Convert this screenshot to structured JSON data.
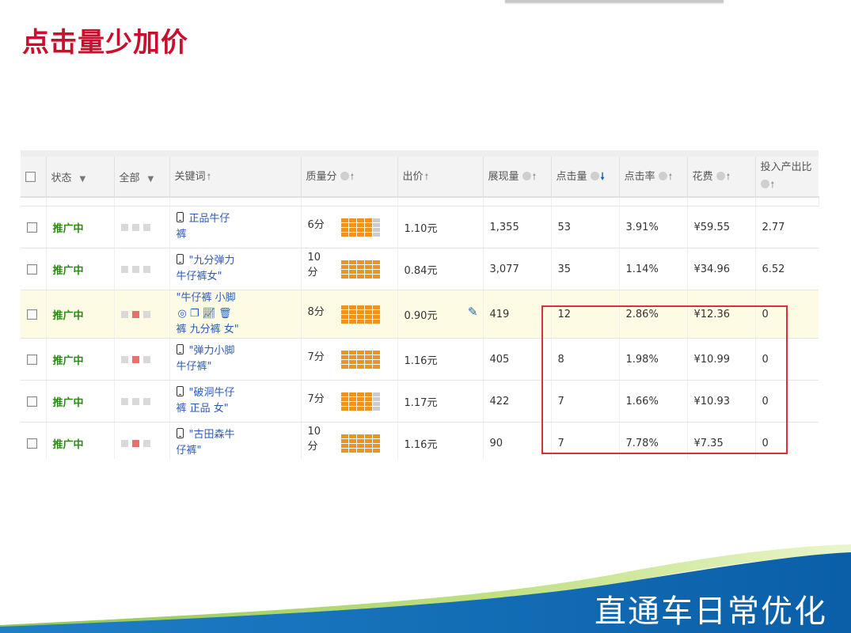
{
  "slide": {
    "title": "点击量少加价",
    "footer": "直通车日常优化"
  },
  "table": {
    "headers": {
      "status": "状态",
      "filter": "全部",
      "keyword": "关键词",
      "quality": "质量分",
      "bid": "出价",
      "impressions": "展现量",
      "clicks": "点击量",
      "ctr": "点击率",
      "cost": "花费",
      "roi_line1": "投入产出比"
    },
    "rows": [
      {
        "status": "推广中",
        "squares": [
          "grey",
          "grey",
          "grey"
        ],
        "kw1": "正品牛仔",
        "kw2": "裤",
        "phone": true,
        "tools": false,
        "quality": "6分",
        "q_level": 0.8,
        "bid": "1.10元",
        "impressions": "1,355",
        "clicks": "53",
        "ctr": "3.91%",
        "cost": "¥59.55",
        "roi": "2.77",
        "highlight": false
      },
      {
        "status": "推广中",
        "squares": [
          "grey",
          "grey",
          "grey"
        ],
        "kw1": "\"九分弹力",
        "kw2": "牛仔裤女\"",
        "phone": true,
        "tools": false,
        "quality": "10分",
        "q_level": 1.0,
        "bid": "0.84元",
        "impressions": "3,077",
        "clicks": "35",
        "ctr": "1.14%",
        "cost": "¥34.96",
        "roi": "6.52",
        "highlight": false
      },
      {
        "status": "推广中",
        "squares": [
          "grey",
          "red",
          "grey"
        ],
        "kw1": "\"牛仔裤 小脚",
        "kw2": "裤 九分裤 女\"",
        "phone": false,
        "tools": true,
        "quality": "8分",
        "q_level": 1.0,
        "bid": "0.90元",
        "impressions": "419",
        "clicks": "12",
        "ctr": "2.86%",
        "cost": "¥12.36",
        "roi": "0",
        "highlight": true
      },
      {
        "status": "推广中",
        "squares": [
          "grey",
          "red",
          "grey"
        ],
        "kw1": "\"弹力小脚",
        "kw2": "牛仔裤\"",
        "phone": true,
        "tools": false,
        "quality": "7分",
        "q_level": 0.9,
        "bid": "1.16元",
        "impressions": "405",
        "clicks": "8",
        "ctr": "1.98%",
        "cost": "¥10.99",
        "roi": "0",
        "highlight": false
      },
      {
        "status": "推广中",
        "squares": [
          "grey",
          "grey",
          "grey"
        ],
        "kw1": "\"破洞牛仔",
        "kw2": "裤 正品 女\"",
        "phone": true,
        "tools": false,
        "quality": "7分",
        "q_level": 0.8,
        "bid": "1.17元",
        "impressions": "422",
        "clicks": "7",
        "ctr": "1.66%",
        "cost": "¥10.93",
        "roi": "0",
        "highlight": false
      },
      {
        "status": "推广中",
        "squares": [
          "grey",
          "red",
          "grey"
        ],
        "kw1": "\"古田森牛",
        "kw2": "仔裤\"",
        "phone": true,
        "tools": false,
        "quality": "10分",
        "q_level": 1.0,
        "bid": "1.16元",
        "impressions": "90",
        "clicks": "7",
        "ctr": "7.78%",
        "cost": "¥7.35",
        "roi": "0",
        "highlight": false
      }
    ]
  },
  "icons": {
    "tool_icons": [
      "target-icon",
      "copy-icon",
      "chart-icon",
      "trash-icon"
    ],
    "edit_icon": "pencil-icon"
  },
  "colors": {
    "title": "#c8102e",
    "status": "#2a8a12",
    "keyword": "#2a5bb5",
    "quality_on": "#f1921b",
    "quality_off": "#cccccc",
    "highlight_row": "#fdfbe3",
    "annotation_box": "#d8313c"
  }
}
